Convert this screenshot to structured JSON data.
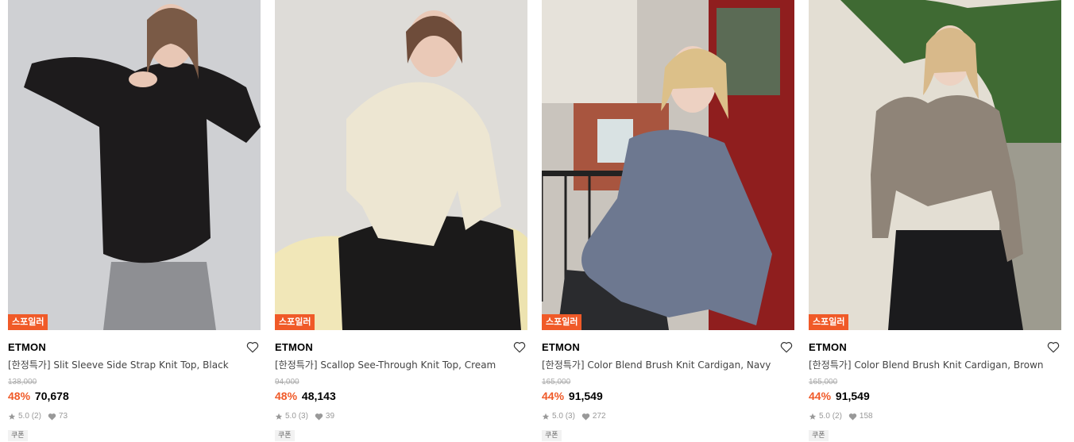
{
  "products": [
    {
      "badge": "스포일러",
      "brand": "ETMON",
      "name": "[한정특가] Slit Sleeve Side Strap Knit Top, Black",
      "original_price": "138,000",
      "discount": "48%",
      "price": "70,678",
      "rating": "5.0",
      "reviews": "(2)",
      "likes": "73",
      "coupon": "쿠폰",
      "image": "model-black-ribbed-knit"
    },
    {
      "badge": "스포일러",
      "brand": "ETMON",
      "name": "[한정특가] Scallop See-Through Knit Top, Cream",
      "original_price": "94,000",
      "discount": "48%",
      "price": "48,143",
      "rating": "5.0",
      "reviews": "(3)",
      "likes": "39",
      "coupon": "쿠폰",
      "image": "model-cream-knit"
    },
    {
      "badge": "스포일러",
      "brand": "ETMON",
      "name": "[한정특가] Color Blend Brush Knit Cardigan, Navy",
      "original_price": "165,000",
      "discount": "44%",
      "price": "91,549",
      "rating": "5.0",
      "reviews": "(3)",
      "likes": "272",
      "coupon": "쿠폰",
      "image": "model-navy-cardigan"
    },
    {
      "badge": "스포일러",
      "brand": "ETMON",
      "name": "[한정특가] Color Blend Brush Knit Cardigan, Brown",
      "original_price": "165,000",
      "discount": "44%",
      "price": "91,549",
      "rating": "5.0",
      "reviews": "(2)",
      "likes": "158",
      "coupon": "쿠폰",
      "image": "model-brown-cardigan"
    }
  ],
  "colors": {
    "accent": "#f05a28",
    "muted": "#999999"
  }
}
